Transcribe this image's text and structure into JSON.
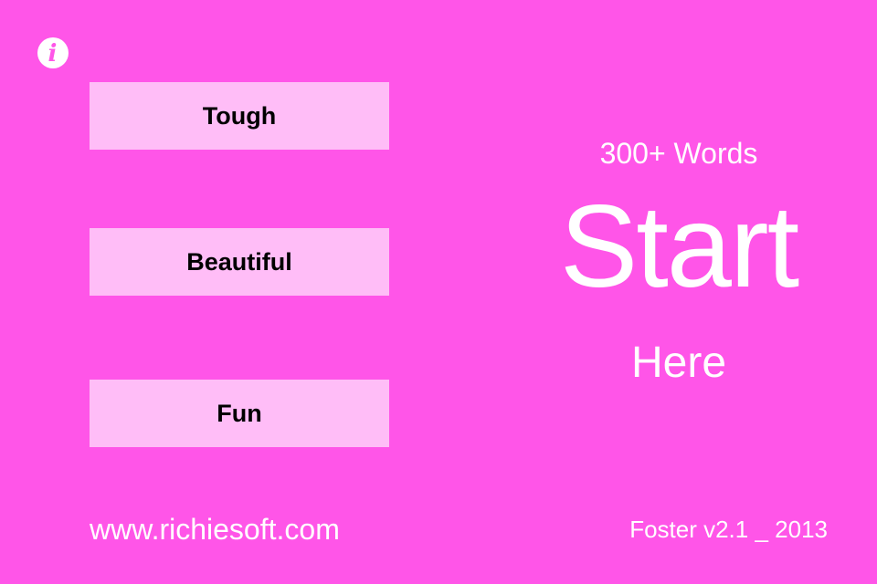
{
  "colors": {
    "background": "#FF55E8",
    "button_fill": "#FFBDF7",
    "text_light": "#FFFFFF",
    "text_dark": "#000000"
  },
  "info_button": {
    "icon": "info-icon",
    "glyph": "i"
  },
  "word_buttons": [
    {
      "label": "Tough"
    },
    {
      "label": "Beautiful"
    },
    {
      "label": "Fun"
    }
  ],
  "hero": {
    "count_label": "300+ Words",
    "start_label": "Start",
    "here_label": "Here"
  },
  "footer": {
    "website": "www.richiesoft.com",
    "version": "Foster v2.1 _ 2013"
  }
}
